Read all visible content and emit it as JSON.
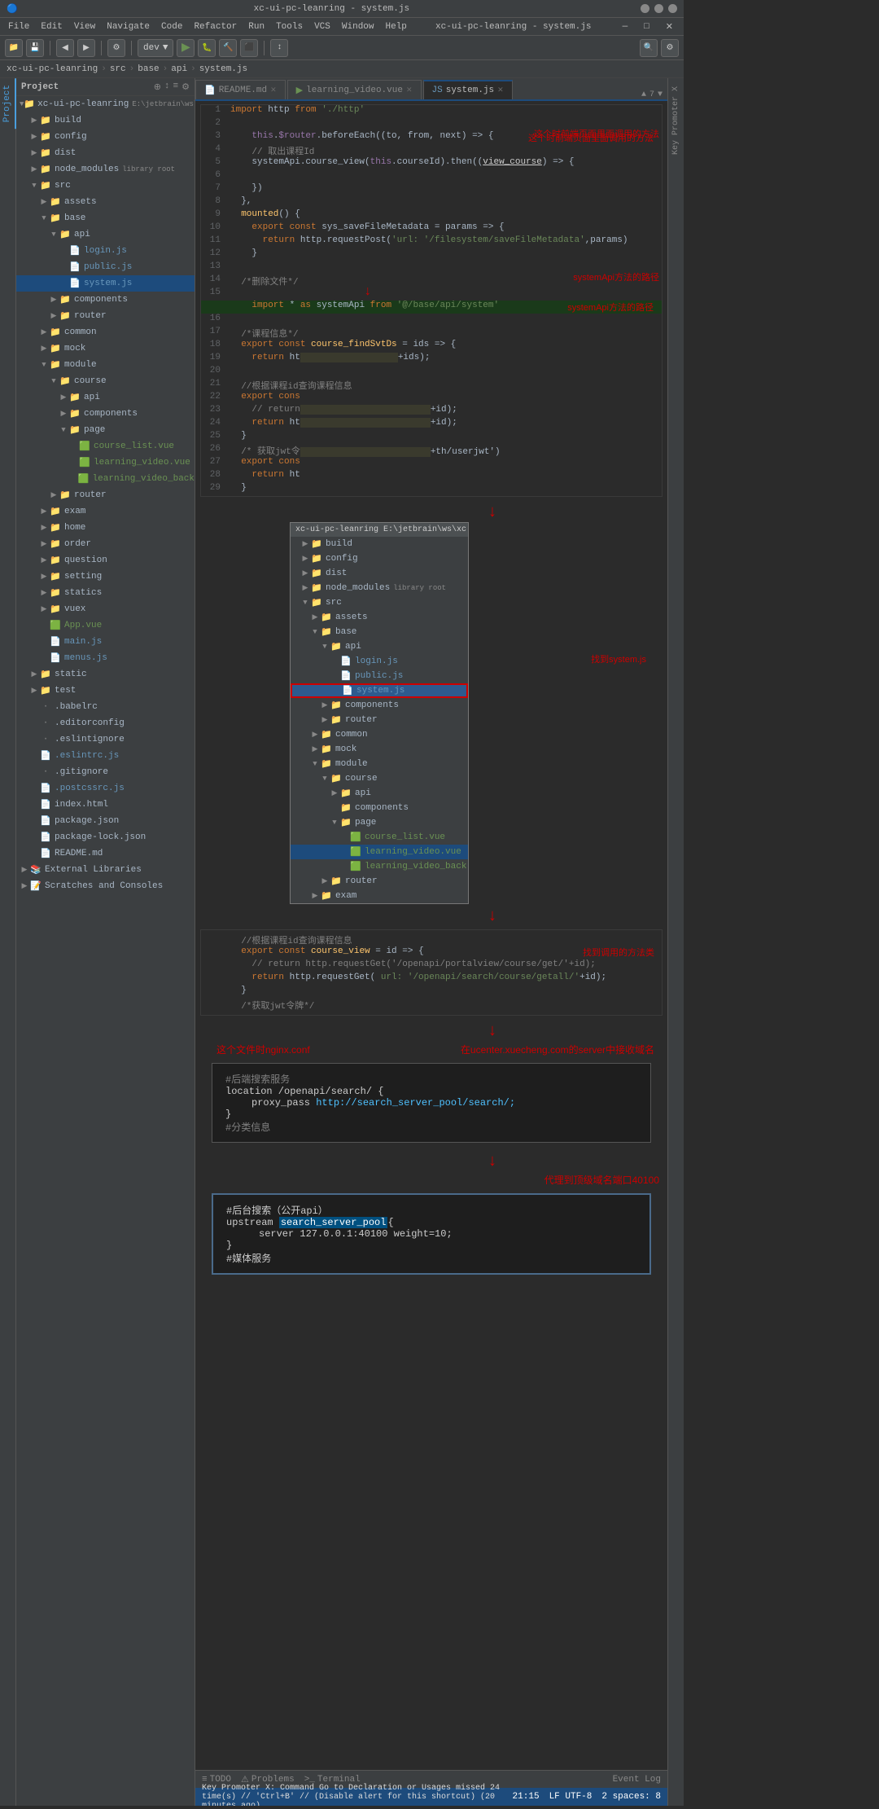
{
  "app": {
    "title": "xc-ui-pc-leanring - system.js",
    "window_controls": [
      "minimize",
      "restore",
      "close"
    ]
  },
  "menu": {
    "items": [
      "File",
      "Edit",
      "View",
      "Navigate",
      "Code",
      "Refactor",
      "Run",
      "Tools",
      "VCS",
      "Window",
      "Help"
    ]
  },
  "toolbar": {
    "dev_label": "dev",
    "run_icon": "▶",
    "search_icon": "🔍"
  },
  "breadcrumb": {
    "parts": [
      "xc-ui-pc-leanring",
      "src",
      "base",
      "api",
      "system.js"
    ]
  },
  "sidebar": {
    "title": "Project",
    "root": "xc-ui-pc-leanring",
    "root_path": "E:\\jetbrain\\ws\\xc",
    "items": [
      {
        "id": "build",
        "name": "build",
        "type": "folder",
        "level": 1,
        "open": false
      },
      {
        "id": "config",
        "name": "config",
        "type": "folder",
        "level": 1,
        "open": false
      },
      {
        "id": "dist",
        "name": "dist",
        "type": "folder",
        "level": 1,
        "open": false
      },
      {
        "id": "node_modules",
        "name": "node_modules",
        "type": "folder",
        "level": 1,
        "open": false,
        "badge": "library root"
      },
      {
        "id": "src",
        "name": "src",
        "type": "folder",
        "level": 1,
        "open": true
      },
      {
        "id": "assets",
        "name": "assets",
        "type": "folder",
        "level": 2,
        "open": false
      },
      {
        "id": "base",
        "name": "base",
        "type": "folder",
        "level": 2,
        "open": true
      },
      {
        "id": "api",
        "name": "api",
        "type": "folder",
        "level": 3,
        "open": true
      },
      {
        "id": "login_js",
        "name": "login.js",
        "type": "js",
        "level": 4
      },
      {
        "id": "public_js",
        "name": "public.js",
        "type": "js",
        "level": 4
      },
      {
        "id": "system_js",
        "name": "system.js",
        "type": "js",
        "level": 4,
        "selected": true
      },
      {
        "id": "components",
        "name": "components",
        "type": "folder",
        "level": 3,
        "open": false
      },
      {
        "id": "router",
        "name": "router",
        "type": "folder",
        "level": 3,
        "open": false
      },
      {
        "id": "common",
        "name": "common",
        "type": "folder",
        "level": 2,
        "open": false
      },
      {
        "id": "mock",
        "name": "mock",
        "type": "folder",
        "level": 2,
        "open": false
      },
      {
        "id": "module",
        "name": "module",
        "type": "folder",
        "level": 2,
        "open": true
      },
      {
        "id": "course",
        "name": "course",
        "type": "folder",
        "level": 3,
        "open": true
      },
      {
        "id": "api2",
        "name": "api",
        "type": "folder",
        "level": 4,
        "open": false
      },
      {
        "id": "components2",
        "name": "components",
        "type": "folder",
        "level": 4,
        "open": false
      },
      {
        "id": "page",
        "name": "page",
        "type": "folder",
        "level": 4,
        "open": true
      },
      {
        "id": "course_list",
        "name": "course_list.vue",
        "type": "vue",
        "level": 5
      },
      {
        "id": "learning_video",
        "name": "learning_video.vue",
        "type": "vue",
        "level": 5
      },
      {
        "id": "learning_video_back",
        "name": "learning_video_back",
        "type": "vue",
        "level": 5
      },
      {
        "id": "router2",
        "name": "router",
        "type": "folder",
        "level": 3,
        "open": false
      },
      {
        "id": "exam",
        "name": "exam",
        "type": "folder",
        "level": 2,
        "open": false
      },
      {
        "id": "home",
        "name": "home",
        "type": "folder",
        "level": 2,
        "open": false
      },
      {
        "id": "order",
        "name": "order",
        "type": "folder",
        "level": 2,
        "open": false
      },
      {
        "id": "question",
        "name": "question",
        "type": "folder",
        "level": 2,
        "open": false
      },
      {
        "id": "setting",
        "name": "setting",
        "type": "folder",
        "level": 2,
        "open": false
      },
      {
        "id": "statics",
        "name": "statics",
        "type": "folder",
        "level": 2,
        "open": false
      },
      {
        "id": "vuex",
        "name": "vuex",
        "type": "folder",
        "level": 2,
        "open": false
      },
      {
        "id": "App_vue",
        "name": "App.vue",
        "type": "vue",
        "level": 2
      },
      {
        "id": "main_js",
        "name": "main.js",
        "type": "js",
        "level": 2
      },
      {
        "id": "menus_js",
        "name": "menus.js",
        "type": "js",
        "level": 2
      },
      {
        "id": "static",
        "name": "static",
        "type": "folder",
        "level": 1,
        "open": false
      },
      {
        "id": "test",
        "name": "test",
        "type": "folder",
        "level": 1,
        "open": false
      },
      {
        "id": "babelrc",
        "name": ".babelrc",
        "type": "dotfile",
        "level": 1
      },
      {
        "id": "editorconfig",
        "name": ".editorconfig",
        "type": "dotfile",
        "level": 1
      },
      {
        "id": "eslintignore",
        "name": ".eslintignore",
        "type": "dotfile",
        "level": 1
      },
      {
        "id": "eslintrc",
        "name": ".eslintrc.js",
        "type": "js",
        "level": 1
      },
      {
        "id": "gitignore",
        "name": ".gitignore",
        "type": "dotfile",
        "level": 1
      },
      {
        "id": "postcssrc",
        "name": ".postcssrc.js",
        "type": "js",
        "level": 1
      },
      {
        "id": "index_html",
        "name": "index.html",
        "type": "html",
        "level": 1
      },
      {
        "id": "package_json",
        "name": "package.json",
        "type": "json",
        "level": 1
      },
      {
        "id": "package_lock",
        "name": "package-lock.json",
        "type": "json",
        "level": 1
      },
      {
        "id": "README",
        "name": "README.md",
        "type": "file",
        "level": 1
      },
      {
        "id": "ext_libs",
        "name": "External Libraries",
        "type": "folder",
        "level": 0
      },
      {
        "id": "scratches",
        "name": "Scratches and Consoles",
        "type": "folder",
        "level": 0
      }
    ]
  },
  "tabs": [
    {
      "id": "readme",
      "label": "README.md",
      "type": "md",
      "active": false
    },
    {
      "id": "learning_video",
      "label": "learning_video.vue",
      "type": "vue",
      "active": false
    },
    {
      "id": "system_js",
      "label": "system.js",
      "type": "js",
      "active": true
    }
  ],
  "code_section1": {
    "lines": [
      {
        "num": "1",
        "content": "    import http from './http'"
      },
      {
        "num": "2",
        "content": ""
      },
      {
        "num": "3",
        "content": "    this.$router.beforeEach((to, from, next) => {"
      },
      {
        "num": "4",
        "content": "    // 取出课程Id"
      },
      {
        "num": "5",
        "content": "    systemApi.course_view(this.courseId).then((view_course) => {"
      },
      {
        "num": "6",
        "content": ""
      },
      {
        "num": "7",
        "content": "    })"
      },
      {
        "num": "8",
        "content": "  },"
      },
      {
        "num": "9",
        "content": "  mounted() {"
      },
      {
        "num": "10",
        "content": "    export const sys_saveFileMetadata = params => {"
      },
      {
        "num": "11",
        "content": "      return http.requestPost('url: '/filesystem/saveFileMetadata',params)"
      },
      {
        "num": "12",
        "content": "    }"
      },
      {
        "num": "13",
        "content": ""
      },
      {
        "num": "14",
        "content": "  /*删除文件*/"
      },
      {
        "num": "15",
        "content": ""
      },
      {
        "num": "",
        "content": "    import * as systemApi from '@/base/api/system'"
      },
      {
        "num": "16",
        "content": ""
      },
      {
        "num": "17",
        "content": "  /*课程信息*/"
      },
      {
        "num": "18",
        "content": "  export const course_findSvtDs = ids => {"
      },
      {
        "num": "19",
        "content": "    return ht                          +ids);"
      },
      {
        "num": "20",
        "content": ""
      },
      {
        "num": "21",
        "content": "  //根据课程id查询课程信息"
      },
      {
        "num": "22",
        "content": "  export cons"
      },
      {
        "num": "23",
        "content": "    // return                          +id);"
      },
      {
        "num": "24",
        "content": "    return ht                          +id);"
      },
      {
        "num": "25",
        "content": "  }"
      },
      {
        "num": "26",
        "content": "  /* 获取jwt令                          +th/userjwt')"
      },
      {
        "num": "27",
        "content": "  export cons"
      },
      {
        "num": "28",
        "content": "    return ht"
      },
      {
        "num": "29",
        "content": "  }"
      }
    ],
    "annotations": {
      "right1": "这个时前端页面里面调用的方法",
      "right2": "systemApi方法的路径",
      "import_text": "import * as systemApi from '@/base/api/system'"
    }
  },
  "popup_tree": {
    "title": "xc-ui-pc-leanring E:\\jetbrain\\ws\\xc",
    "items": [
      {
        "name": "build",
        "type": "folder",
        "level": 0
      },
      {
        "name": "config",
        "type": "folder",
        "level": 0
      },
      {
        "name": "dist",
        "type": "folder",
        "level": 0
      },
      {
        "name": "node_modules",
        "type": "folder",
        "level": 0,
        "badge": "library root"
      },
      {
        "name": "src",
        "type": "folder",
        "level": 0,
        "open": true
      },
      {
        "name": "assets",
        "type": "folder",
        "level": 1
      },
      {
        "name": "base",
        "type": "folder",
        "level": 1,
        "open": true
      },
      {
        "name": "api",
        "type": "folder",
        "level": 2,
        "open": true
      },
      {
        "name": "login.js",
        "type": "js",
        "level": 3
      },
      {
        "name": "public.js",
        "type": "js",
        "level": 3
      },
      {
        "name": "system.js",
        "type": "js",
        "level": 3,
        "selected": true
      },
      {
        "name": "components",
        "type": "folder",
        "level": 2
      },
      {
        "name": "router",
        "type": "folder",
        "level": 2
      },
      {
        "name": "common",
        "type": "folder",
        "level": 1
      },
      {
        "name": "mock",
        "type": "folder",
        "level": 1
      },
      {
        "name": "module",
        "type": "folder",
        "level": 1,
        "open": true
      },
      {
        "name": "course",
        "type": "folder",
        "level": 2,
        "open": true
      },
      {
        "name": "api",
        "type": "folder",
        "level": 3
      },
      {
        "name": "components",
        "type": "folder",
        "level": 3
      },
      {
        "name": "page",
        "type": "folder",
        "level": 3,
        "open": true
      },
      {
        "name": "course_list.vue",
        "type": "vue",
        "level": 4
      },
      {
        "name": "learning_video.vue",
        "type": "vue",
        "level": 4,
        "selected2": true
      },
      {
        "name": "learning_video_back",
        "type": "vue",
        "level": 4
      },
      {
        "name": "router",
        "type": "folder",
        "level": 2
      },
      {
        "name": "exam",
        "type": "folder",
        "level": 1
      }
    ],
    "annotation": "找到system.js"
  },
  "code_section2": {
    "annotation_top": "//根据课程id查询课程信息",
    "lines": [
      {
        "num": "",
        "content": "  //根据课程id查询课程信息"
      },
      {
        "num": "",
        "content": "  export const course_view = id => {"
      },
      {
        "num": "",
        "content": "    // return http.requestGet('/openapi/portalview/course/get/'+id);"
      },
      {
        "num": "",
        "content": "    return http.requestGet( url: '/openapi/search/course/getall/'+id);"
      },
      {
        "num": "",
        "content": "  }"
      },
      {
        "num": "",
        "content": "  /*获取jwt令牌*/"
      }
    ],
    "annotation_right": "找到调用的方法类"
  },
  "nginx_section": {
    "annotation": "这个文件时nginx.conf",
    "annotation2": "在ucenter.xuecheng.com的server中接收域名",
    "content_lines": [
      "#后端搜索服务",
      "location /openapi/search/ {",
      "    proxy_pass http://search_server_pool/search/;",
      "}"
    ],
    "comment": "#分类信息",
    "link_text": "http://search_server_pool/search/;"
  },
  "upstream_section": {
    "annotation": "代理到顶级域名端口40100",
    "lines": [
      "#后台搜索（公开api）",
      "upstream search_server_pool{",
      "    server 127.0.0.1:40100 weight=10;",
      "}",
      "#媒体服务"
    ],
    "highlight_text": "search_server_pool"
  },
  "bottom_tabs": [
    "TODO",
    "Problems",
    "Terminal"
  ],
  "status_bar": {
    "shortcut_hint": "Key Promoter X: Command Go to Declaration or Usages missed 24 time(s) // 'Ctrl+B' // (Disable alert for this shortcut) (20 minutes ago)",
    "line_col": "21:15",
    "encoding": "LF  UTF-8",
    "spaces": "2 spaces: 8"
  }
}
